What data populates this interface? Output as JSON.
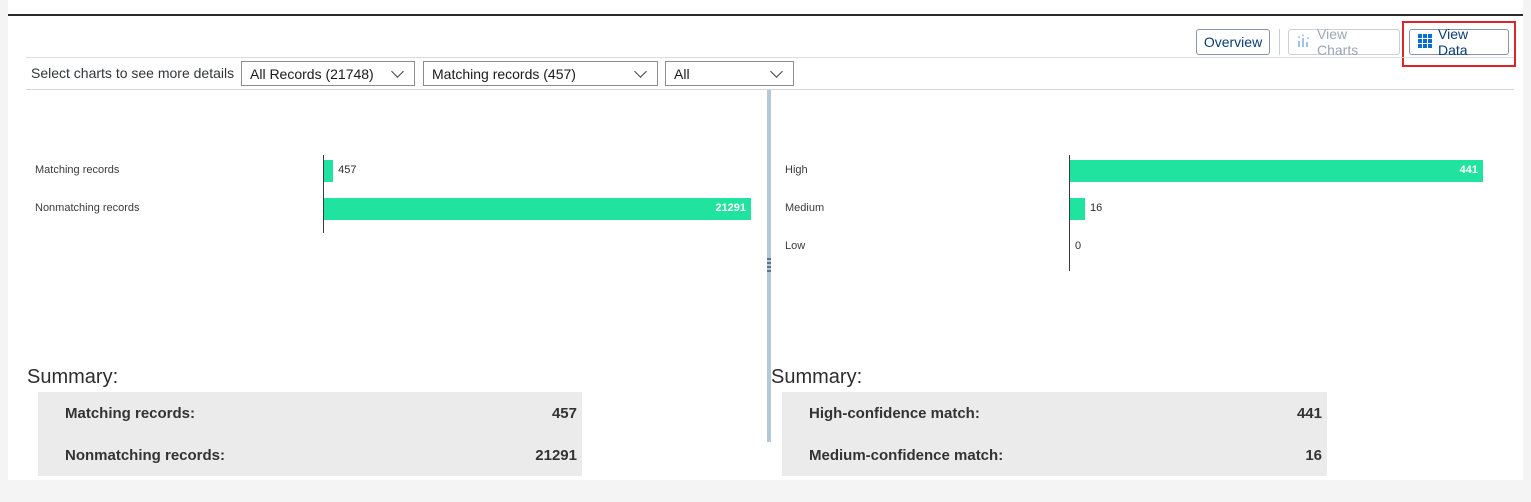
{
  "toolbar": {
    "overview_label": "Overview",
    "view_charts_label": "View Charts",
    "view_data_label": "View Data",
    "view_charts_icon": "chart-icon",
    "view_data_icon": "grid-icon"
  },
  "filters": {
    "label": "Select charts to see more details",
    "selects": [
      {
        "value": "All Records (21748)"
      },
      {
        "value": "Matching records (457)"
      },
      {
        "value": "All"
      }
    ]
  },
  "left_panel": {
    "summary_title": "Summary:",
    "summary": [
      {
        "label": "Matching records:",
        "value": "457"
      },
      {
        "label": "Nonmatching records:",
        "value": "21291"
      }
    ]
  },
  "right_panel": {
    "summary_title": "Summary:",
    "summary": [
      {
        "label": "High-confidence match:",
        "value": "441"
      },
      {
        "label": "Medium-confidence match:",
        "value": "16"
      }
    ]
  },
  "colors": {
    "bar": "#21e3a0",
    "highlight": "#d9262a",
    "accent": "#0a6ed1"
  },
  "chart_data": [
    {
      "type": "bar",
      "orientation": "horizontal",
      "categories": [
        "Matching records",
        "Nonmatching records"
      ],
      "values": [
        457,
        21291
      ]
    },
    {
      "type": "bar",
      "orientation": "horizontal",
      "categories": [
        "High",
        "Medium",
        "Low"
      ],
      "values": [
        441,
        16,
        0
      ]
    }
  ]
}
